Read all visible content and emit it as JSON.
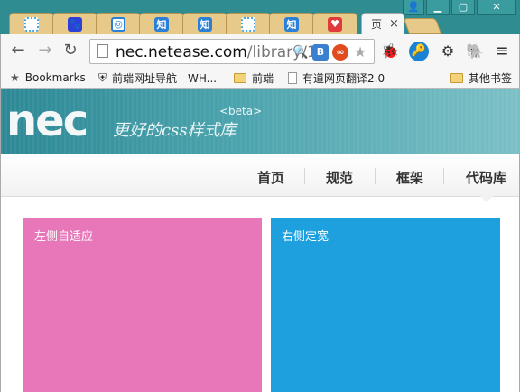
{
  "browser": {
    "active_tab": {
      "title": "页",
      "close": "×"
    },
    "tabs": [
      {
        "icon": "loading-icon",
        "color": "#4aa8e0"
      },
      {
        "icon": "baidu-paw-icon",
        "color": "#2c3fd6"
      },
      {
        "icon": "chrome-web-store-icon",
        "color": "#2a7fd6"
      },
      {
        "icon": "zhihu-icon",
        "text": "知",
        "color": "#2a7fd6"
      },
      {
        "icon": "zhihu-icon",
        "text": "知",
        "color": "#2a7fd6"
      },
      {
        "icon": "loading-icon",
        "color": "#4aa8e0"
      },
      {
        "icon": "zhihu-icon",
        "text": "知",
        "color": "#2a7fd6"
      },
      {
        "icon": "heart-icon",
        "color": "#e03b3b"
      }
    ],
    "url_host": "nec.netease.com",
    "url_path": "/library/1",
    "window_controls": {
      "minimize": "▁",
      "maximize": "▢",
      "close": "✕",
      "user": "👤"
    },
    "nav": {
      "back": "←",
      "forward": "→",
      "reload": "↻"
    }
  },
  "bookmarks_bar": {
    "items": [
      {
        "label": "Bookmarks",
        "icon": "star-icon"
      },
      {
        "label": "前端网址导航 - WH...",
        "icon": "shield-icon"
      },
      {
        "label": "前端",
        "icon": "folder-icon"
      },
      {
        "label": "有道网页翻译2.0",
        "icon": "page-icon"
      }
    ],
    "other": {
      "label": "其他书签",
      "icon": "folder-icon"
    }
  },
  "site": {
    "logo": "nec",
    "tagline": "更好的css样式库",
    "beta": "<beta>",
    "nav": [
      "首页",
      "规范",
      "框架",
      "代码库"
    ],
    "left_box": "左侧自适应",
    "right_box": "右侧定宽",
    "colors": {
      "left": "#e777b8",
      "right": "#1ea0df",
      "banner": "#2d8896"
    }
  }
}
